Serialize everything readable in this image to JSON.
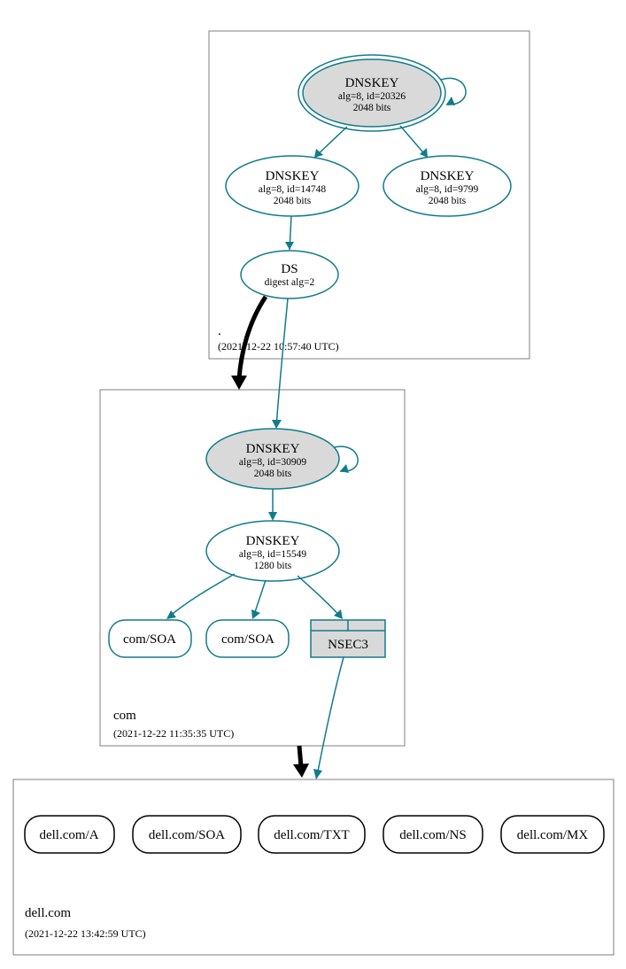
{
  "zones": {
    "root": {
      "label": ".",
      "time": "(2021-12-22 10:57:40 UTC)"
    },
    "com": {
      "label": "com",
      "time": "(2021-12-22 11:35:35 UTC)"
    },
    "dell": {
      "label": "dell.com",
      "time": "(2021-12-22 13:42:59 UTC)"
    }
  },
  "nodes": {
    "root_ksk": {
      "t": "DNSKEY",
      "l1": "alg=8, id=20326",
      "l2": "2048 bits"
    },
    "root_zsk": {
      "t": "DNSKEY",
      "l1": "alg=8, id=14748",
      "l2": "2048 bits"
    },
    "root_zsk2": {
      "t": "DNSKEY",
      "l1": "alg=8, id=9799",
      "l2": "2048 bits"
    },
    "root_ds": {
      "t": "DS",
      "l1": "digest alg=2"
    },
    "com_ksk": {
      "t": "DNSKEY",
      "l1": "alg=8, id=30909",
      "l2": "2048 bits"
    },
    "com_zsk": {
      "t": "DNSKEY",
      "l1": "alg=8, id=15549",
      "l2": "1280 bits"
    },
    "com_soa1": {
      "t": "com/SOA"
    },
    "com_soa2": {
      "t": "com/SOA"
    },
    "nsec3": {
      "t": "NSEC3"
    },
    "dell_a": {
      "t": "dell.com/A"
    },
    "dell_soa": {
      "t": "dell.com/SOA"
    },
    "dell_txt": {
      "t": "dell.com/TXT"
    },
    "dell_ns": {
      "t": "dell.com/NS"
    },
    "dell_mx": {
      "t": "dell.com/MX"
    }
  }
}
